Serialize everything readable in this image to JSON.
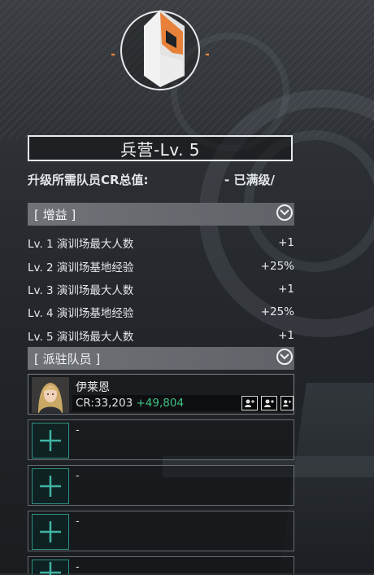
{
  "building": {
    "title": "兵营-Lv. 5",
    "cr_label": "升级所需队员CR总值:",
    "cr_value": "- 已满级/"
  },
  "buffs_section": {
    "title": "[ 增益 ]",
    "items": [
      {
        "level": "Lv. 1 演训场最大人数",
        "value": "+1"
      },
      {
        "level": "Lv. 2 演训场基地经验",
        "value": "+25%"
      },
      {
        "level": "Lv. 3 演训场最大人数",
        "value": "+1"
      },
      {
        "level": "Lv. 4 演训场基地经验",
        "value": "+25%"
      },
      {
        "level": "Lv. 5 演训场最大人数",
        "value": "+1"
      }
    ]
  },
  "members_section": {
    "title": "[ 派驻队员 ]",
    "member": {
      "name": "伊莱恩",
      "cr": "CR:33,203",
      "bonus": "+49,804"
    },
    "empty_slots": [
      "-",
      "-",
      "-",
      "-"
    ]
  },
  "colors": {
    "accent_orange": "#e8823a",
    "bonus_green": "#3fc285",
    "slot_teal": "#2f8f84"
  },
  "icons": [
    "barracks-emblem-icon",
    "chevron-down-icon",
    "user-plus-icon",
    "add-plus-icon"
  ]
}
